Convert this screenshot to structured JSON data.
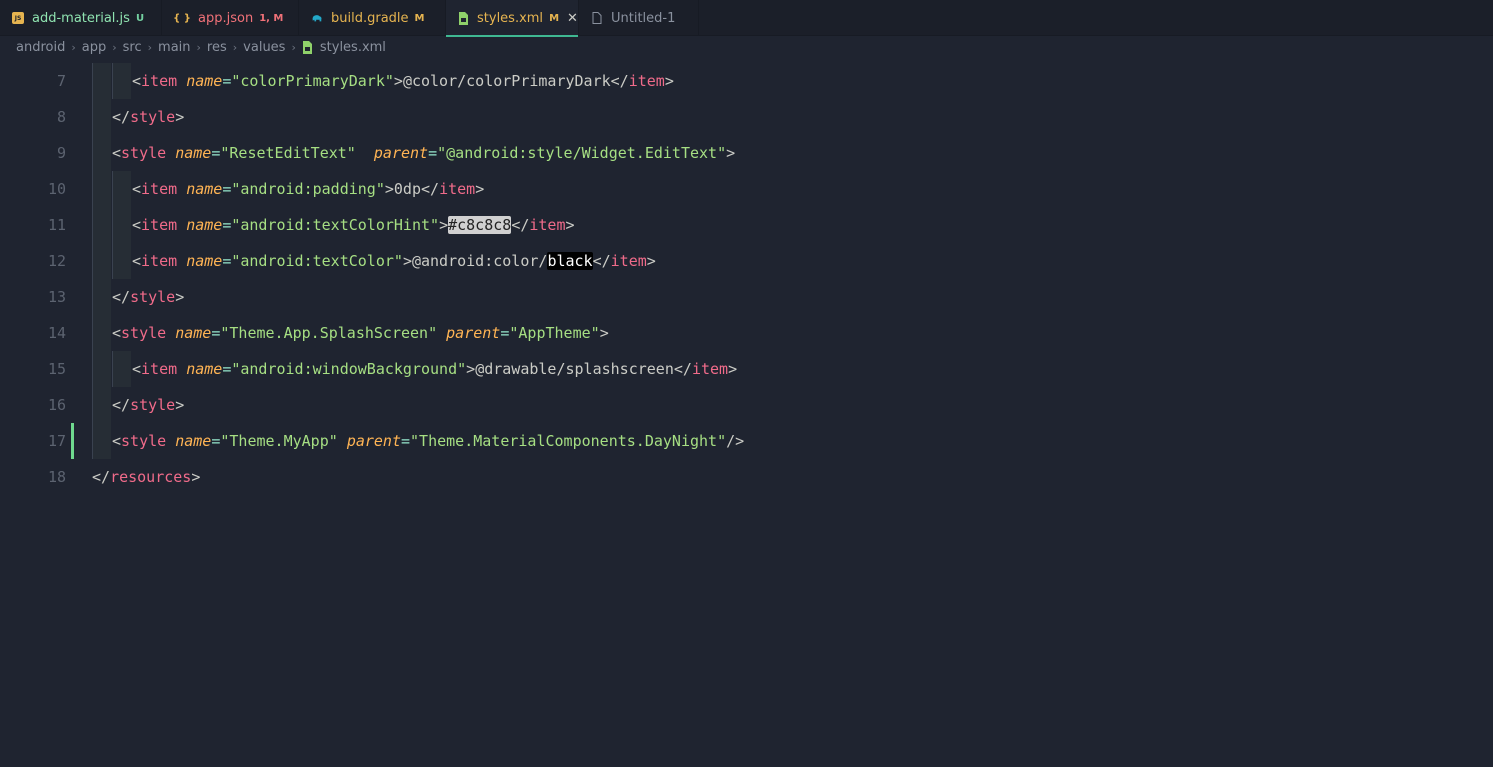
{
  "tabs": [
    {
      "name": "add-material.js",
      "badge": "U",
      "icon": "js-file-icon",
      "badge_color": "#73d0a0",
      "name_color": "#8fe3b0",
      "icon_label": "JS"
    },
    {
      "name": "app.json",
      "badge": "1, M",
      "icon": "json-file-icon",
      "badge_color": "#f07178",
      "name_color": "#f07178",
      "icon_label": "{ }"
    },
    {
      "name": "build.gradle",
      "badge": "M",
      "icon": "gradle-elephant-icon",
      "badge_color": "#e6b450",
      "name_color": "#e6b450",
      "icon_label": ""
    },
    {
      "name": "styles.xml",
      "badge": "M",
      "icon": "xml-file-icon",
      "badge_color": "#e6b450",
      "name_color": "#e6b450",
      "icon_label": ""
    },
    {
      "name": "Untitled-1",
      "badge": "",
      "icon": "file-icon",
      "badge_color": "#8a919e",
      "name_color": "#8a919e",
      "icon_label": ""
    }
  ],
  "active_tab_close": "✕",
  "breadcrumb": [
    "android",
    "app",
    "src",
    "main",
    "res",
    "values",
    "styles.xml"
  ],
  "breadcrumb_separator": "›",
  "lines": [
    {
      "n": "7"
    },
    {
      "n": "8"
    },
    {
      "n": "9"
    },
    {
      "n": "10"
    },
    {
      "n": "11"
    },
    {
      "n": "12"
    },
    {
      "n": "13"
    },
    {
      "n": "14"
    },
    {
      "n": "15"
    },
    {
      "n": "16"
    },
    {
      "n": "17"
    },
    {
      "n": "18"
    }
  ],
  "code": {
    "l7": {
      "tag": "item",
      "attr": "name",
      "val": "\"colorPrimaryDark\"",
      "text": "@color/colorPrimaryDark"
    },
    "l8": {
      "tag": "style"
    },
    "l9": {
      "tag": "style",
      "attr1": "name",
      "val1": "\"ResetEditText\"",
      "attr2": "parent",
      "val2": "\"@android:style/Widget.EditText\""
    },
    "l10": {
      "tag": "item",
      "attr": "name",
      "val": "\"android:padding\"",
      "text": "0dp"
    },
    "l11": {
      "tag": "item",
      "attr": "name",
      "val": "\"android:textColorHint\"",
      "text": "#c8c8c8"
    },
    "l12": {
      "tag": "item",
      "attr": "name",
      "val": "\"android:textColor\"",
      "text_a": "@android:color/",
      "text_b": "black"
    },
    "l13": {
      "tag": "style"
    },
    "l14": {
      "tag": "style",
      "attr1": "name",
      "val1": "\"Theme.App.SplashScreen\"",
      "attr2": "parent",
      "val2": "\"AppTheme\""
    },
    "l15": {
      "tag": "item",
      "attr": "name",
      "val": "\"android:windowBackground\"",
      "text": "@drawable/splashscreen"
    },
    "l16": {
      "tag": "style"
    },
    "l17": {
      "tag": "style",
      "attr1": "name",
      "val1": "\"Theme.MyApp\"",
      "attr2": "parent",
      "val2": "\"Theme.MaterialComponents.DayNight\""
    },
    "l18": {
      "tag": "resources"
    }
  },
  "colors": {
    "accent": "#3fb892",
    "modified_gutter": "#6fd98e",
    "background": "#1f2430"
  }
}
